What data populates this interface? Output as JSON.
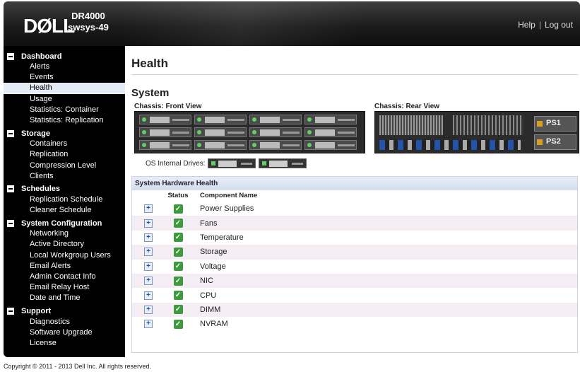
{
  "header": {
    "logo": "DØLL",
    "product": "DR4000",
    "hostname": "swsys-49",
    "help": "Help",
    "separator": "|",
    "logout": "Log out"
  },
  "sidebar": {
    "groups": [
      {
        "label": "Dashboard",
        "items": [
          "Alerts",
          "Events",
          "Health",
          "Usage",
          "Statistics: Container",
          "Statistics: Replication"
        ]
      },
      {
        "label": "Storage",
        "items": [
          "Containers",
          "Replication",
          "Compression Level",
          "Clients"
        ]
      },
      {
        "label": "Schedules",
        "items": [
          "Replication Schedule",
          "Cleaner Schedule"
        ]
      },
      {
        "label": "System Configuration",
        "items": [
          "Networking",
          "Active Directory",
          "Local Workgroup Users",
          "Email Alerts",
          "Admin Contact Info",
          "Email Relay Host",
          "Date and Time"
        ]
      },
      {
        "label": "Support",
        "items": [
          "Diagnostics",
          "Software Upgrade",
          "License"
        ]
      }
    ],
    "active_item": "Health"
  },
  "main": {
    "page_title": "Health",
    "section_title": "System",
    "front_label": "Chassis: Front View",
    "rear_label": "Chassis: Rear View",
    "os_drives_label": "OS Internal Drives:",
    "ps1": "PS1",
    "ps2": "PS2"
  },
  "hardware": {
    "title": "System Hardware Health",
    "col_status": "Status",
    "col_component": "Component Name",
    "rows": [
      "Power Supplies",
      "Fans",
      "Temperature",
      "Storage",
      "Voltage",
      "NIC",
      "CPU",
      "DIMM",
      "NVRAM"
    ],
    "status_colors": {
      "ok": "#3d9a3d"
    }
  },
  "footer": {
    "copyright": "Copyright © 2011 - 2013 Dell Inc. All rights reserved."
  }
}
